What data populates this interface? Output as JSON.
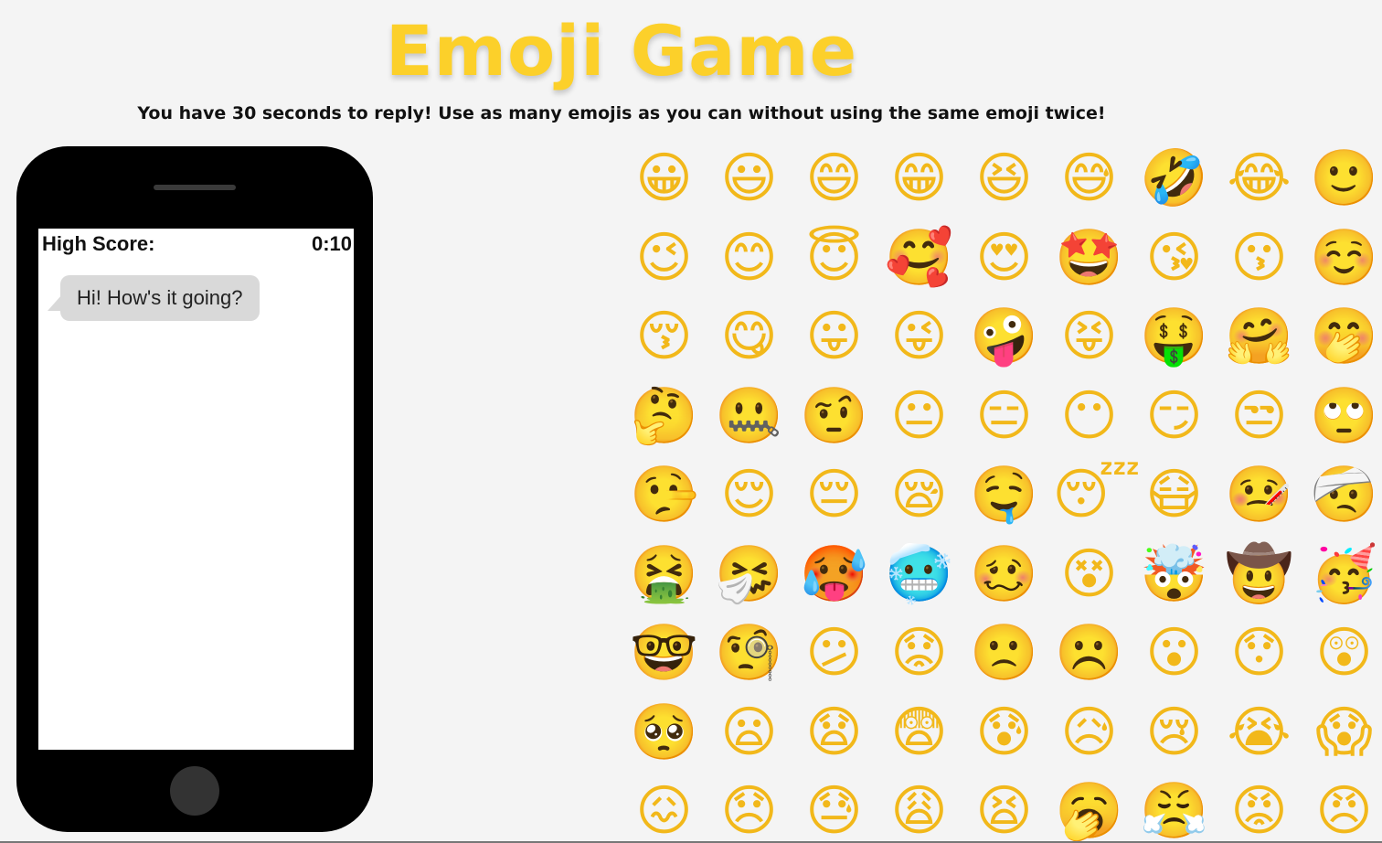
{
  "header": {
    "title": "Emoji Game",
    "subtitle": "You have 30 seconds to reply! Use as many emojis as you can without using the same emoji twice!"
  },
  "phone": {
    "high_score_label": "High Score:",
    "timer": "0:10",
    "message": "Hi! How's it going?"
  },
  "colors": {
    "title": "#fcd02a",
    "phone_body": "#000000",
    "bubble": "#d9d9d9",
    "background": "#f4f4f4"
  },
  "emojis": [
    "😀",
    "😃",
    "😄",
    "😁",
    "😆",
    "😅",
    "🤣",
    "😂",
    "🙂",
    "😉",
    "😊",
    "😇",
    "🥰",
    "😍",
    "🤩",
    "😘",
    "😗",
    "☺️",
    "😚",
    "😋",
    "😛",
    "😜",
    "🤪",
    "😝",
    "🤑",
    "🤗",
    "🤭",
    "🤔",
    "🤐",
    "🤨",
    "😐",
    "😑",
    "😶",
    "😏",
    "😒",
    "🙄",
    "🤥",
    "😌",
    "😔",
    "😪",
    "🤤",
    "😴",
    "😷",
    "🤒",
    "🤕",
    "🤮",
    "🤧",
    "🥵",
    "🥶",
    "🥴",
    "😵",
    "🤯",
    "🤠",
    "🥳",
    "🤓",
    "🧐",
    "😕",
    "😟",
    "🙁",
    "☹️",
    "😮",
    "😯",
    "😲",
    "🥺",
    "😦",
    "😧",
    "😨",
    "😰",
    "😥",
    "😢",
    "😭",
    "😱",
    "😖",
    "😞",
    "😓",
    "😩",
    "😫",
    "🥱",
    "😤",
    "😡",
    "😠"
  ]
}
